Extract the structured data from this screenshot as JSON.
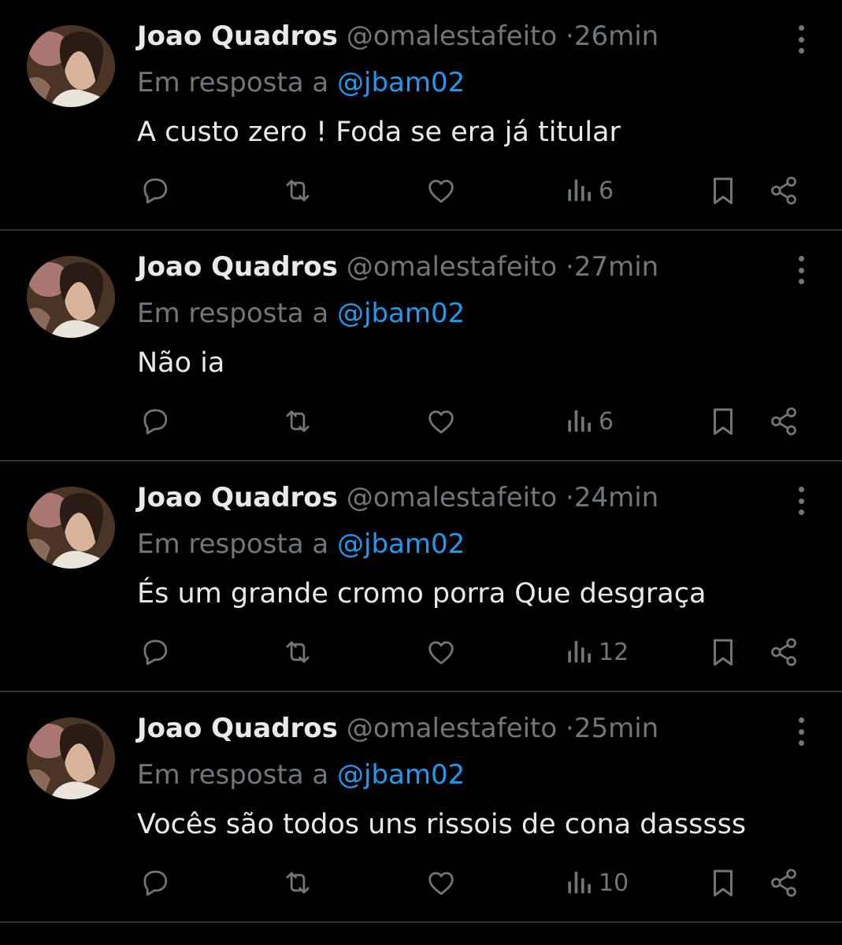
{
  "colors": {
    "background": "#000000",
    "divider": "#2f3336",
    "text": "#e7e9ea",
    "muted": "#71767b",
    "link": "#1d9bf0"
  },
  "icons": {
    "more": "more-vertical-icon",
    "reply": "reply-icon",
    "retweet": "retweet-icon",
    "like": "heart-icon",
    "views": "views-icon",
    "bookmark": "bookmark-icon",
    "share": "share-icon"
  },
  "tweets": [
    {
      "name": "Joao Quadros",
      "handle": "@omalestafeito",
      "separator": "·",
      "time": "26min",
      "reply_prefix": "Em resposta a",
      "reply_to": "@jbam02",
      "text": "A custo zero ! Foda se era já titular",
      "views": "6"
    },
    {
      "name": "Joao Quadros",
      "handle": "@omalestafeito",
      "separator": "·",
      "time": "27min",
      "reply_prefix": "Em resposta a",
      "reply_to": "@jbam02",
      "text": "Não ia",
      "views": "6"
    },
    {
      "name": "Joao Quadros",
      "handle": "@omalestafeito",
      "separator": "·",
      "time": "24min",
      "reply_prefix": "Em resposta a",
      "reply_to": "@jbam02",
      "text": "És um grande cromo  porra Que desgraça",
      "views": "12"
    },
    {
      "name": "Joao Quadros",
      "handle": "@omalestafeito",
      "separator": "·",
      "time": "25min",
      "reply_prefix": "Em resposta a",
      "reply_to": "@jbam02",
      "text": "Vocês são todos uns rissois de cona dasssss",
      "views": "10"
    }
  ]
}
